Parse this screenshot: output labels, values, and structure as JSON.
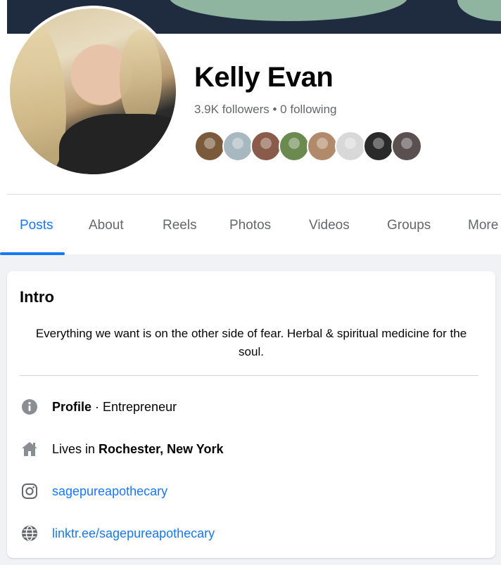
{
  "profile": {
    "name": "Kelly Evan",
    "followers_line": "3.9K followers • 0 following",
    "friend_avatar_colors": [
      "#7a5a3a",
      "#a8b8c0",
      "#8a5a4a",
      "#6a8a50",
      "#b08a6a",
      "#d8d8d8",
      "#2a2a2a",
      "#5a5050"
    ]
  },
  "tabs": [
    {
      "label": "Posts",
      "active": true
    },
    {
      "label": "About",
      "active": false
    },
    {
      "label": "Reels",
      "active": false
    },
    {
      "label": "Photos",
      "active": false
    },
    {
      "label": "Videos",
      "active": false
    },
    {
      "label": "Groups",
      "active": false
    },
    {
      "label": "More",
      "active": false
    }
  ],
  "intro": {
    "title": "Intro",
    "bio": "Everything we want is on the other side of fear. Herbal & spiritual medicine for the soul.",
    "profile_label": "Profile",
    "profile_sep": " · ",
    "profile_category": "Entrepreneur",
    "lives_prefix": "Lives in ",
    "lives_city": "Rochester, New York",
    "instagram": "sagepureapothecary",
    "website": "linktr.ee/sagepureapothecary"
  },
  "icons": {
    "info": "info-circle-icon",
    "home": "home-icon",
    "instagram": "instagram-icon",
    "globe": "globe-icon"
  },
  "colors": {
    "accent": "#1877f2",
    "muted_text": "#65676b",
    "icon_gray": "#8a8d91"
  }
}
